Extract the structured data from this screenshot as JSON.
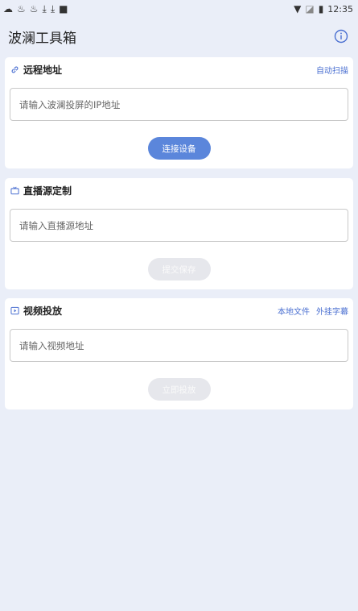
{
  "status_bar": {
    "left_icons": [
      "cloud-icon",
      "notification-icon",
      "notification-icon",
      "download-icon",
      "download-icon",
      "square-icon"
    ],
    "right_icons": [
      "wifi-icon",
      "signal-icon",
      "battery-icon"
    ],
    "time": "12:35"
  },
  "header": {
    "title": "波澜工具箱",
    "info_icon": "info-icon"
  },
  "remote": {
    "title": "远程地址",
    "icon": "link-icon",
    "link": "自动扫描",
    "placeholder": "请输入波澜投屏的IP地址",
    "button": "连接设备",
    "button_enabled": true
  },
  "live": {
    "title": "直播源定制",
    "icon": "tv-icon",
    "placeholder": "请输入直播源地址",
    "button": "提交保存",
    "button_enabled": false
  },
  "video": {
    "title": "视频投放",
    "icon": "play-icon",
    "links": [
      "本地文件",
      "外挂字幕"
    ],
    "placeholder": "请输入视频地址",
    "button": "立即投放",
    "button_enabled": false
  },
  "colors": {
    "accent": "#5b86db",
    "link": "#4a6fd1",
    "background": "#eaeef8",
    "disabled": "#e6e7ec"
  }
}
